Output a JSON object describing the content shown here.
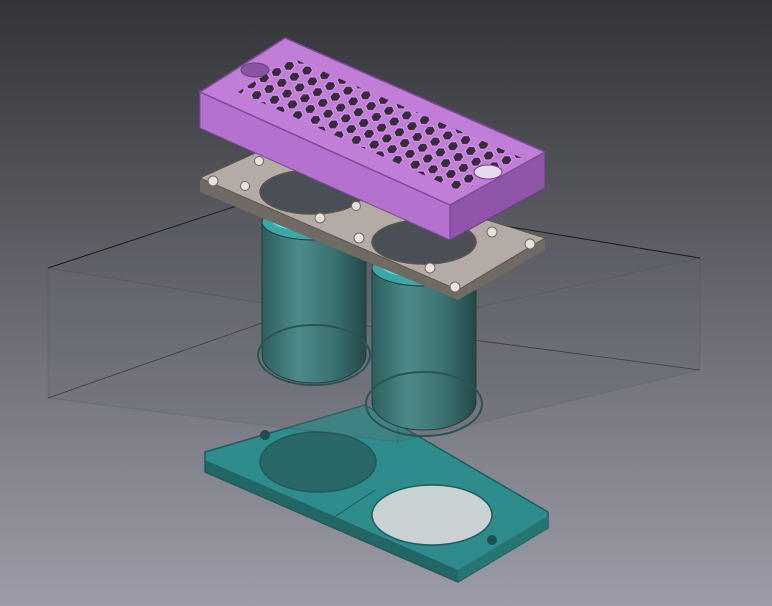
{
  "viewport": {
    "background_top": "#333438",
    "background_bottom": "#9c9ca8"
  },
  "colors": {
    "lid": "#c07ed8",
    "lid_dark": "#8f56a8",
    "lid_side": "#b571cf",
    "gasket": "#b4aca4",
    "gasket_dark": "#6f6a64",
    "cup": "#3e7a7a",
    "cup_rim": "#5fe8e8",
    "base_plate": "#2f8c8c",
    "base_plate_edge": "#1f5c5c",
    "box_edge": "#1a1a1a"
  },
  "parts": {
    "lid": "honeycomb-lid",
    "gasket": "mounting-gasket",
    "cups": [
      "left-cylinder-cup",
      "right-cylinder-cup"
    ],
    "base": "base-plate",
    "enclosure": "transparent-enclosure-box"
  }
}
